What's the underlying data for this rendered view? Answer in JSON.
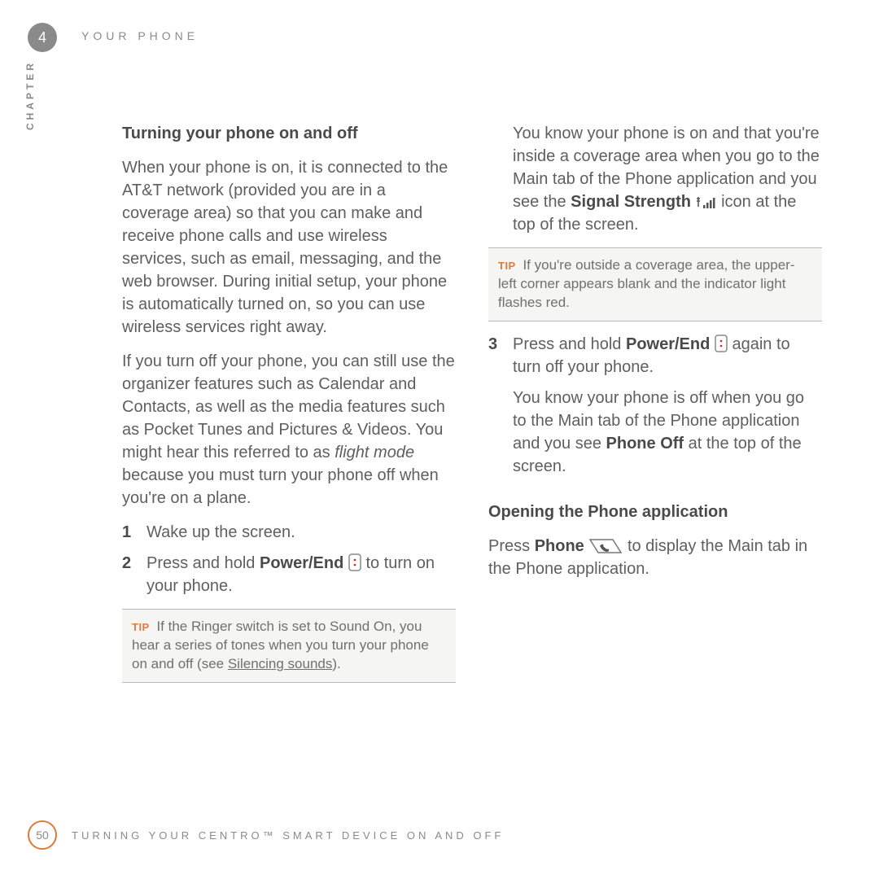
{
  "header": {
    "chapter_number": "4",
    "chapter_title": "YOUR PHONE",
    "side_label": "CHAPTER"
  },
  "left": {
    "h1": "Turning your phone on and off",
    "p1": "When your phone is on, it is connected to the AT&T network (provided you are in a coverage area) so that you can make and receive phone calls and use wireless services, such as email, messaging, and the web browser. During initial setup, your phone is automatically turned on, so you can use wireless services right away.",
    "p2a": "If you turn off your phone, you can still use the organizer features such as Calendar and Contacts, as well as the media features such as Pocket Tunes and Pictures & Videos. You might hear this referred to as ",
    "p2i": "flight mode",
    "p2b": " because you must turn your phone off when you're on a plane.",
    "step1": "Wake up the screen.",
    "step2a": "Press and hold ",
    "step2b": "Power/End",
    "step2c": " to turn on your phone.",
    "tip_label": "TIP",
    "tip_a": " If the Ringer switch is set to Sound On, you hear a series of tones when you turn your phone on and off (see ",
    "tip_link": "Silencing sounds",
    "tip_b": ")."
  },
  "right": {
    "p1a": "You know your phone is on and that you're inside a coverage area when you go to the Main tab of the Phone application and you see the ",
    "p1b": "Signal Strength",
    "p1c": " icon at the top of the screen.",
    "tip_label": "TIP",
    "tip": " If you're outside a coverage area, the upper-left corner appears blank and the indicator light flashes red.",
    "step3a": "Press and hold ",
    "step3b": "Power/End",
    "step3c": " again to turn off your phone.",
    "step3p2a": "You know your phone is off when you go to the Main tab of the Phone application and you see ",
    "step3p2b": "Phone Off",
    "step3p2c": " at the top of the screen.",
    "h2": "Opening the Phone application",
    "h2p_a": "Press ",
    "h2p_b": "Phone",
    "h2p_c": " to display the Main tab in the Phone application."
  },
  "footer": {
    "page_number": "50",
    "title": "TURNING YOUR CENTRO™ SMART DEVICE ON AND OFF"
  }
}
